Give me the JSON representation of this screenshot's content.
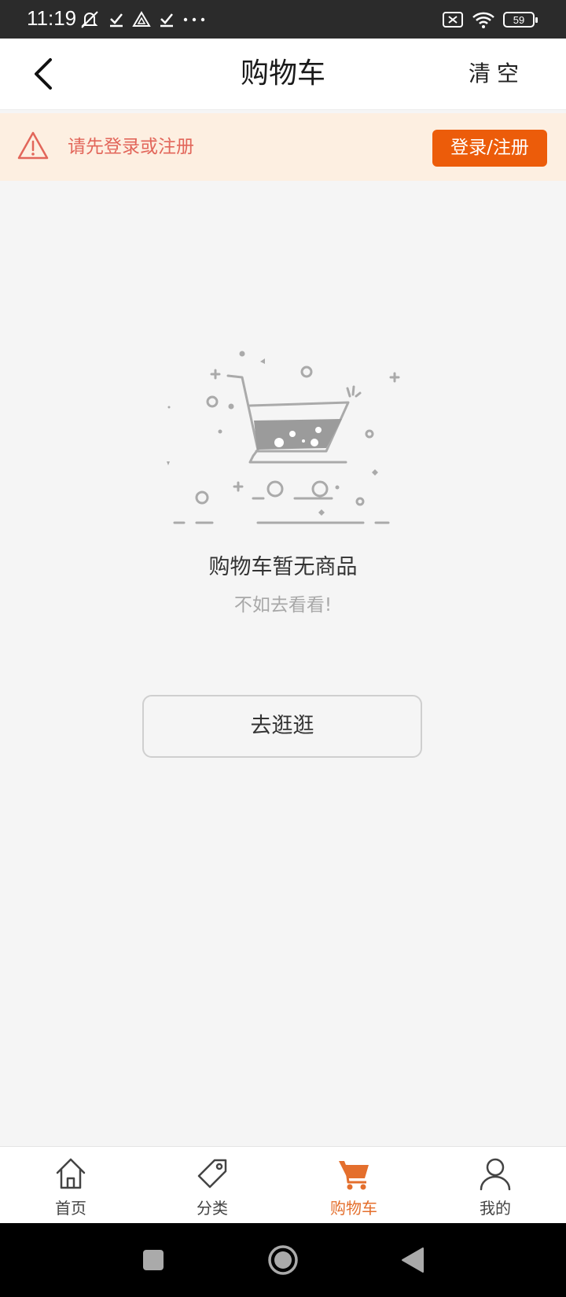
{
  "status_bar": {
    "time": "11:19",
    "battery_level": "59",
    "left_icons": [
      "mute-icon",
      "check-icon",
      "drive-icon",
      "check-icon",
      "more-icon"
    ],
    "right_icons": [
      "no-sim-icon",
      "wifi-icon",
      "battery-icon"
    ]
  },
  "header": {
    "title": "购物车",
    "clear_label": "清空"
  },
  "login_banner": {
    "message": "请先登录或注册",
    "button_label": "登录/注册"
  },
  "empty_state": {
    "title": "购物车暂无商品",
    "subtitle": "不如去看看!",
    "button_label": "去逛逛"
  },
  "tab_bar": {
    "active_color": "#e46f2d",
    "items": [
      {
        "label": "首页",
        "icon": "home-icon"
      },
      {
        "label": "分类",
        "icon": "tag-icon"
      },
      {
        "label": "购物车",
        "icon": "cart-icon",
        "active": true
      },
      {
        "label": "我的",
        "icon": "user-icon"
      }
    ]
  },
  "colors": {
    "accent": "#ec5c0a",
    "warning_text": "#e2665a",
    "banner_bg": "#fdefe1",
    "page_bg": "#f5f5f5"
  }
}
